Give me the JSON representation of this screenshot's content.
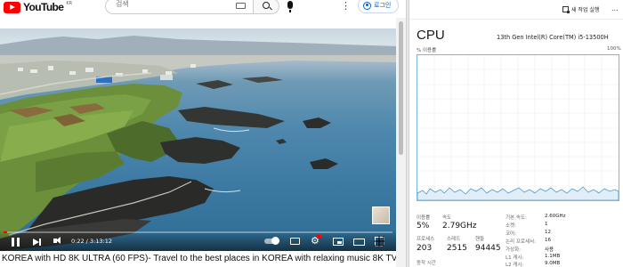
{
  "youtube": {
    "logo_text": "YouTube",
    "logo_region": "KR",
    "search": {
      "placeholder": "검색"
    },
    "login_label": "로그인",
    "video": {
      "title": "KOREA with HD 8K ULTRA (60 FPS)- Travel to the best places in KOREA with relaxing music 8K TV",
      "time_display": "0:22 / 3:13:12",
      "progress_fraction": 0.002
    }
  },
  "task_manager": {
    "run_task_label": "새 작업 실행",
    "more_label": "...",
    "title": "CPU",
    "cpu_model": "13th Gen Intel(R) Core(TM) i5-13500H",
    "util_label": "% 이용률",
    "util_max": "100%",
    "graph_color": "#7cb6dc",
    "stats": {
      "utilization": {
        "label": "이용률",
        "value": "5%"
      },
      "speed": {
        "label": "속도",
        "value": "2.79GHz"
      },
      "processes": {
        "label": "프로세스",
        "value": "203"
      },
      "threads": {
        "label": "스레드",
        "value": "2515"
      },
      "handles": {
        "label": "핸들",
        "value": "94445"
      },
      "uptime": {
        "label": "동작 시간"
      }
    },
    "specs": [
      {
        "key": "기본 속도:",
        "value": "2.60GHz"
      },
      {
        "key": "소켓:",
        "value": "1"
      },
      {
        "key": "코어:",
        "value": "12"
      },
      {
        "key": "논리 프로세서:",
        "value": "16"
      },
      {
        "key": "가상화:",
        "value": "사용"
      },
      {
        "key": "L1 캐시:",
        "value": "1.1MB"
      },
      {
        "key": "L2 캐시:",
        "value": "9.0MB"
      }
    ]
  }
}
